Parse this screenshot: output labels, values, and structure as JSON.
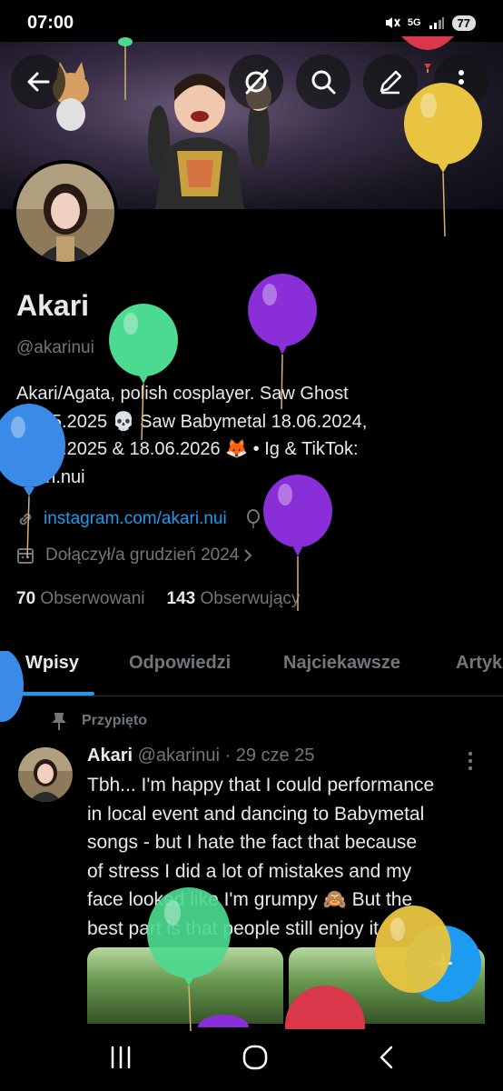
{
  "status": {
    "time": "07:00",
    "network": "5G",
    "battery": "77"
  },
  "profile": {
    "name": "Akari",
    "handle": "@akarinui",
    "bio_lines": [
      "Akari/Agata, polish cosplayer.  Saw Ghost",
      "10.05.2025 💀 Saw Babymetal 18.06.2024,",
      "19.05.2025 & 18.06.2026 🦊 • Ig & TikTok:",
      "akari.nui"
    ],
    "link": "instagram.com/akari.nui",
    "birthday": "Sto lat!",
    "joined": "Dołączył/a grudzień 2024",
    "following_count": "70",
    "following_label": "Obserwowani",
    "followers_count": "143",
    "followers_label": "Obserwujący"
  },
  "tabs": [
    {
      "label": "Wpisy",
      "active": true
    },
    {
      "label": "Odpowiedzi",
      "active": false
    },
    {
      "label": "Najciekawsze",
      "active": false
    },
    {
      "label": "Artykuły",
      "active": false
    }
  ],
  "tweet": {
    "pinned_label": "Przypięto",
    "author": "Akari",
    "handle": "@akarinui",
    "date": "· 29 cze 25",
    "text_lines": [
      "Tbh... I'm happy that I could performance",
      "in local event and dancing to Babymetal",
      "songs - but I hate the fact that because",
      "of stress I did a lot of mistakes and my",
      "face looked like I'm grumpy 🙈 But the",
      "best part is that people still enjoy it 🎈"
    ]
  },
  "fab": {
    "label": "+"
  },
  "colors": {
    "accent": "#1d9bf0",
    "background": "#000000",
    "muted": "#71767b",
    "text": "#e7e9ea"
  },
  "icons": [
    "back-arrow-icon",
    "grok-icon",
    "search-icon",
    "compose-icon",
    "more-vertical-icon",
    "link-icon",
    "balloon-icon",
    "calendar-icon",
    "pin-icon",
    "recent-apps-icon",
    "home-icon",
    "back-nav-icon"
  ]
}
